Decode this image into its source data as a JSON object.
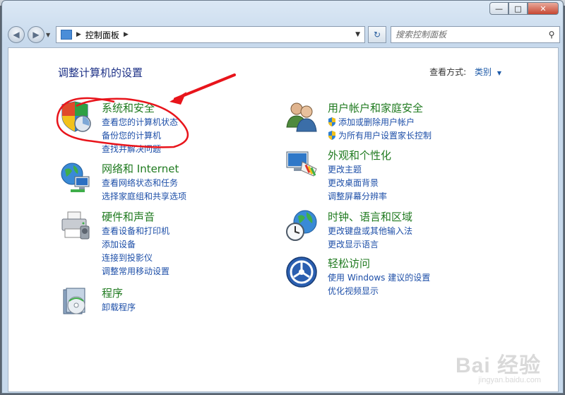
{
  "window": {
    "minimize_glyph": "—",
    "maximize_glyph": "□",
    "close_glyph": "✕"
  },
  "toolbar": {
    "back_glyph": "◀",
    "forward_glyph": "▶",
    "breadcrumb": "控制面板",
    "search_placeholder": "搜索控制面板",
    "refresh_glyph": "↻"
  },
  "main": {
    "heading": "调整计算机的设置",
    "view_by_label": "查看方式:",
    "view_by_value": "类别"
  },
  "categories_left": [
    {
      "title": "系统和安全",
      "icon": "shield-security-icon",
      "links": [
        "查看您的计算机状态",
        "备份您的计算机",
        "查找并解决问题"
      ]
    },
    {
      "title": "网络和 Internet",
      "icon": "network-globe-icon",
      "links": [
        "查看网络状态和任务",
        "选择家庭组和共享选项"
      ]
    },
    {
      "title": "硬件和声音",
      "icon": "printer-icon",
      "links": [
        "查看设备和打印机",
        "添加设备",
        "连接到投影仪",
        "调整常用移动设置"
      ]
    },
    {
      "title": "程序",
      "icon": "programs-disc-icon",
      "links": [
        "卸载程序"
      ]
    }
  ],
  "categories_right": [
    {
      "title": "用户帐户和家庭安全",
      "icon": "users-icon",
      "links": [
        "添加或删除用户帐户",
        "为所有用户设置家长控制"
      ]
    },
    {
      "title": "外观和个性化",
      "icon": "monitor-palette-icon",
      "links": [
        "更改主题",
        "更改桌面背景",
        "调整屏幕分辨率"
      ]
    },
    {
      "title": "时钟、语言和区域",
      "icon": "clock-globe-icon",
      "links": [
        "更改键盘或其他输入法",
        "更改显示语言"
      ]
    },
    {
      "title": "轻松访问",
      "icon": "ease-of-access-icon",
      "links": [
        "使用 Windows 建议的设置",
        "优化视频显示"
      ]
    }
  ],
  "watermark": {
    "main": "Bai 经验",
    "sub": "jingyan.baidu.com"
  },
  "colors": {
    "category_title": "#1f7a1f",
    "link": "#1e4fa8",
    "heading": "#1e3287",
    "annotation": "#e8141b"
  }
}
